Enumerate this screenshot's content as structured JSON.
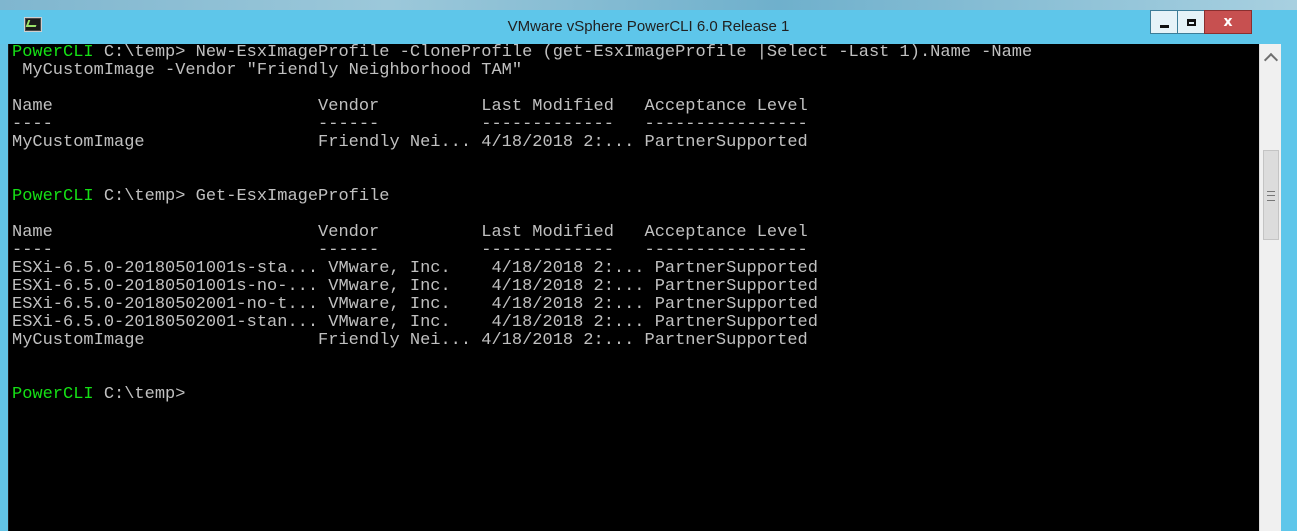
{
  "window": {
    "title": "VMware vSphere PowerCLI 6.0 Release 1",
    "buttons": {
      "minimize": "minimize",
      "maximize": "maximize",
      "close": "x"
    }
  },
  "colors": {
    "prompt": "#15e015",
    "text": "#c0c0c0",
    "background": "#000000",
    "titlebar": "#5ec6ea",
    "close": "#c75050"
  },
  "console": {
    "lines": [
      {
        "prompt": "PowerCLI",
        "text": " C:\\temp> New-EsxImageProfile -CloneProfile (get-EsxImageProfile |Select -Last 1).Name -Name"
      },
      {
        "prompt": "",
        "text": " MyCustomImage -Vendor \"Friendly Neighborhood TAM\""
      },
      {
        "prompt": "",
        "text": ""
      },
      {
        "prompt": "",
        "text": "Name                          Vendor          Last Modified   Acceptance Level"
      },
      {
        "prompt": "",
        "text": "----                          ------          -------------   ----------------"
      },
      {
        "prompt": "",
        "text": "MyCustomImage                 Friendly Nei... 4/18/2018 2:... PartnerSupported"
      },
      {
        "prompt": "",
        "text": ""
      },
      {
        "prompt": "",
        "text": ""
      },
      {
        "prompt": "PowerCLI",
        "text": " C:\\temp> Get-EsxImageProfile"
      },
      {
        "prompt": "",
        "text": ""
      },
      {
        "prompt": "",
        "text": "Name                          Vendor          Last Modified   Acceptance Level"
      },
      {
        "prompt": "",
        "text": "----                          ------          -------------   ----------------"
      },
      {
        "prompt": "",
        "text": "ESXi-6.5.0-20180501001s-sta... VMware, Inc.    4/18/2018 2:... PartnerSupported"
      },
      {
        "prompt": "",
        "text": "ESXi-6.5.0-20180501001s-no-... VMware, Inc.    4/18/2018 2:... PartnerSupported"
      },
      {
        "prompt": "",
        "text": "ESXi-6.5.0-20180502001-no-t... VMware, Inc.    4/18/2018 2:... PartnerSupported"
      },
      {
        "prompt": "",
        "text": "ESXi-6.5.0-20180502001-stan... VMware, Inc.    4/18/2018 2:... PartnerSupported"
      },
      {
        "prompt": "",
        "text": "MyCustomImage                 Friendly Nei... 4/18/2018 2:... PartnerSupported"
      },
      {
        "prompt": "",
        "text": ""
      },
      {
        "prompt": "",
        "text": ""
      },
      {
        "prompt": "PowerCLI",
        "text": " C:\\temp>"
      }
    ]
  }
}
